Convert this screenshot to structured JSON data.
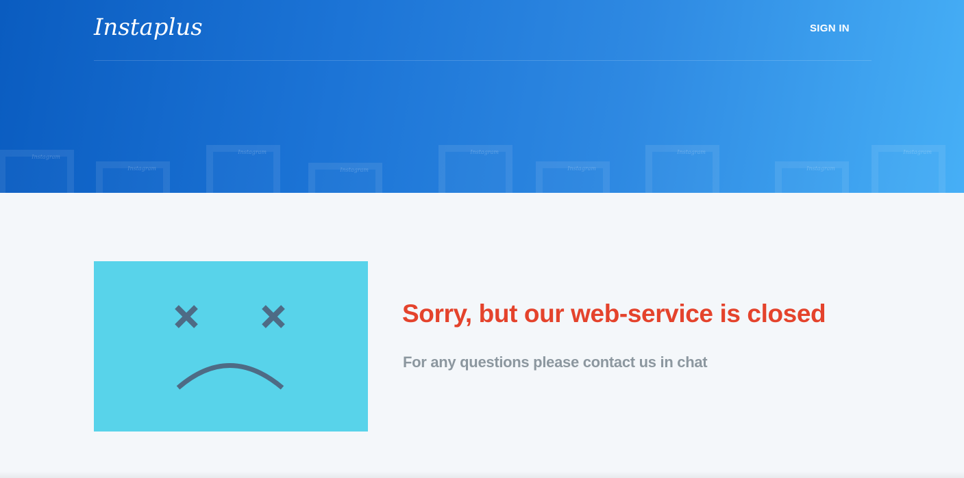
{
  "header": {
    "logo_text": "Instaplus",
    "signin_label": "SIGN IN",
    "background_gradient": [
      "#0a5cc0",
      "#46aff6"
    ],
    "decor_frame_label": "Instagram"
  },
  "main": {
    "illustration": {
      "icon": "sad-face-icon",
      "background_color": "#58d3ea",
      "face_color": "#4e6b85"
    },
    "title": "Sorry, but our web-service is closed",
    "subtitle": "For any questions please contact us in chat",
    "title_color": "#e4432c",
    "subtitle_color": "#8c979f"
  }
}
